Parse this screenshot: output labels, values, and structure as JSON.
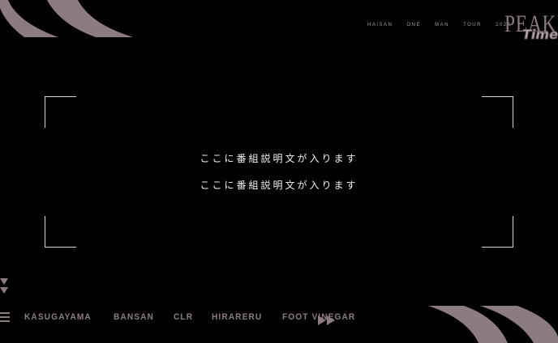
{
  "header": {
    "tour_text": "HAISAN   ONE   MAN   TOUR   2024",
    "logo": {
      "top": "PEAK",
      "script": "Time"
    }
  },
  "main": {
    "description_lines": [
      "ここに番組説明文が入ります",
      "ここに番組説明文が入ります"
    ]
  },
  "nav": {
    "menu_icon": "hamburger-menu-icon",
    "items": [
      {
        "label": "KASUGAYAMA"
      },
      {
        "label": "BANSAN"
      },
      {
        "label": "CLR"
      },
      {
        "label": "HIRARERU"
      },
      {
        "label": "FOOT VINEGAR"
      }
    ],
    "next_icon": "fast-forward-icon"
  },
  "icons": {
    "scroll": "double-chevron-down-icon"
  },
  "colors": {
    "background": "#010101",
    "accent": "#8d7b84",
    "frame": "#d8d8d8",
    "text": "#f2f2f2"
  }
}
